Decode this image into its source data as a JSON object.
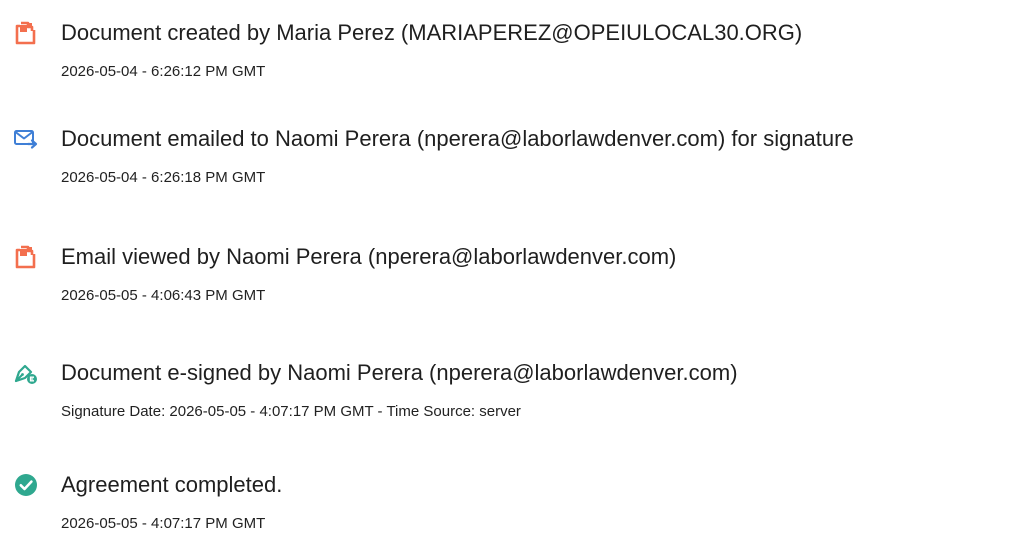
{
  "colors": {
    "document_icon": "#f36f4e",
    "email_icon": "#3f7fd6",
    "signature_icon": "#2fa88f",
    "complete_icon": "#2fa88f"
  },
  "events": [
    {
      "icon": "document-icon",
      "title": "Document created by Maria Perez (MARIAPEREZ@OPEIULOCAL30.ORG)",
      "meta": "2026-05-04 - 6:26:12 PM GMT"
    },
    {
      "icon": "email-sent-icon",
      "title": "Document emailed to Naomi Perera (nperera@laborlawdenver.com) for signature",
      "meta": "2026-05-04 - 6:26:18 PM GMT"
    },
    {
      "icon": "document-icon",
      "title": "Email viewed by Naomi Perera (nperera@laborlawdenver.com)",
      "meta": "2026-05-05 - 4:06:43 PM GMT"
    },
    {
      "icon": "e-signature-icon",
      "title": "Document e-signed by Naomi Perera (nperera@laborlawdenver.com)",
      "meta": "Signature Date: 2026-05-05 - 4:07:17 PM GMT - Time Source: server"
    },
    {
      "icon": "checkmark-circle-icon",
      "title": "Agreement completed.",
      "meta": "2026-05-05 - 4:07:17 PM GMT"
    }
  ]
}
